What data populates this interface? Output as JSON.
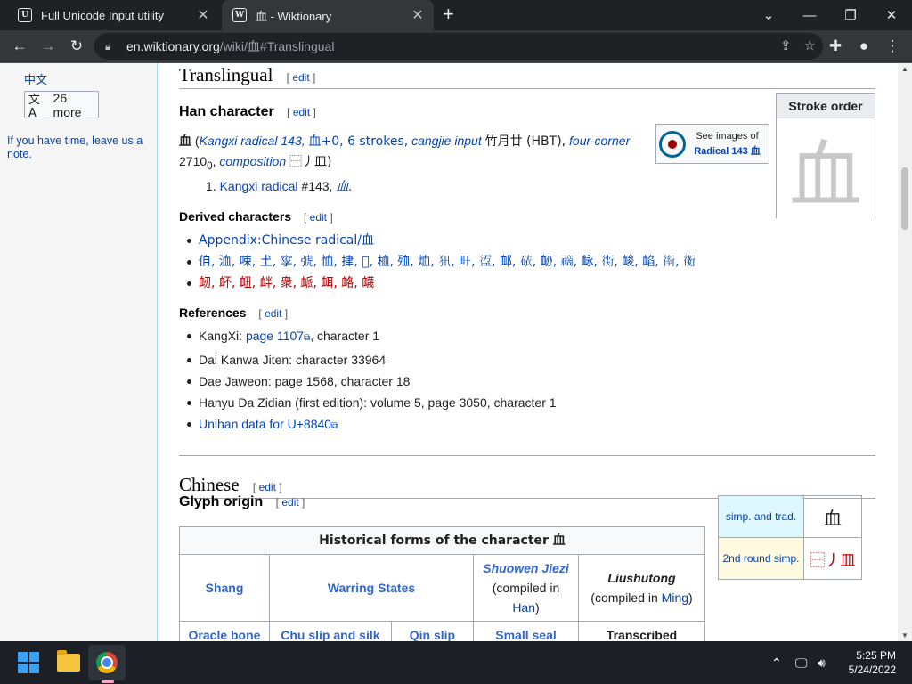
{
  "browser": {
    "tabs": [
      {
        "title": "Full Unicode Input utility",
        "favicon": "U"
      },
      {
        "title": "血 - Wiktionary",
        "favicon": "W"
      }
    ],
    "url_domain": "en.wiktionary.org",
    "url_path": "/wiki/血#Translingual"
  },
  "sidebar": {
    "lang_link": "中文",
    "more_label": "26 more",
    "note": "If you have time, leave us a note."
  },
  "translingual": {
    "heading": "Translingual",
    "edit": "edit",
    "han_heading": "Han character",
    "han_glyph": "血",
    "han_desc_open": "(",
    "kangxi": "Kangxi radical 143,",
    "radical_part": "血+0, 6 strokes,",
    "cangjie_label": "cangjie input",
    "cangjie_value": "竹月廿 (HBT),",
    "four_corner_label": "four-corner",
    "four_corner_value": "2710",
    "four_corner_sub": "0",
    "composition_label": "composition",
    "composition_value": "⿱丿皿)",
    "def_num": "1.",
    "def_link": "Kangxi radical",
    "def_text": "#143,",
    "def_glyph": "⾎.",
    "commons_top": "See images of",
    "commons_bottom": "Radical 143 血",
    "stroke_order_title": "Stroke order",
    "stroke_glyph": "血",
    "derived_heading": "Derived characters",
    "derived": [
      "Appendix:Chinese radical/血",
      "㑑, 洫, 𠲿, 𡈽, 𡥜, 𢏯, 恤, 𢫫, 𣳚, 桖, 殈, 烅, 𤜢, 𤰟, 𥁡, 䘏, 𥑴, 䘐, 𥛚, 䘑, 𧗰, 䘒, 䘓, 𧗵, 𧗸",
      "衂, 衃, 衄, 衅, 衆, 衇, 衈, 衉, 衊"
    ],
    "references_heading": "References",
    "references": [
      {
        "prefix": "KangXi: ",
        "link": "page 1107",
        "suffix": ", character 1"
      },
      {
        "prefix": "Dai Kanwa Jiten: character 33964",
        "link": "",
        "suffix": ""
      },
      {
        "prefix": "Dae Jaweon: page 1568, character 18",
        "link": "",
        "suffix": ""
      },
      {
        "prefix": "Hanyu Da Zidian (first edition): volume 5, page 3050, character 1",
        "link": "",
        "suffix": ""
      },
      {
        "prefix": "",
        "link": "Unihan data for U+8840",
        "suffix": ""
      }
    ]
  },
  "chinese": {
    "heading": "Chinese",
    "glyph_origin_heading": "Glyph origin",
    "table_caption": "Historical forms of the character 血",
    "row1": [
      "Shang",
      "Warring States",
      "Shuowen Jiezi",
      "(compiled in ",
      "Han",
      ")",
      "Liushutong",
      "(compiled in ",
      "Ming",
      ")"
    ],
    "row2": [
      "Oracle bone script",
      "Chu slip and silk script",
      "Qin slip script",
      "Small seal script",
      "Transcribed ancient scripts"
    ],
    "simp_label1": "simp. and trad.",
    "simp_value1": "血",
    "simp_label2": "2nd round simp.",
    "simp_value2": "⿱丿皿"
  },
  "taskbar": {
    "time": "5:25 PM",
    "date": "5/24/2022"
  },
  "colors": {
    "link": "#0645ad",
    "redlink": "#ba0000",
    "tab_bg": "#35363a"
  }
}
